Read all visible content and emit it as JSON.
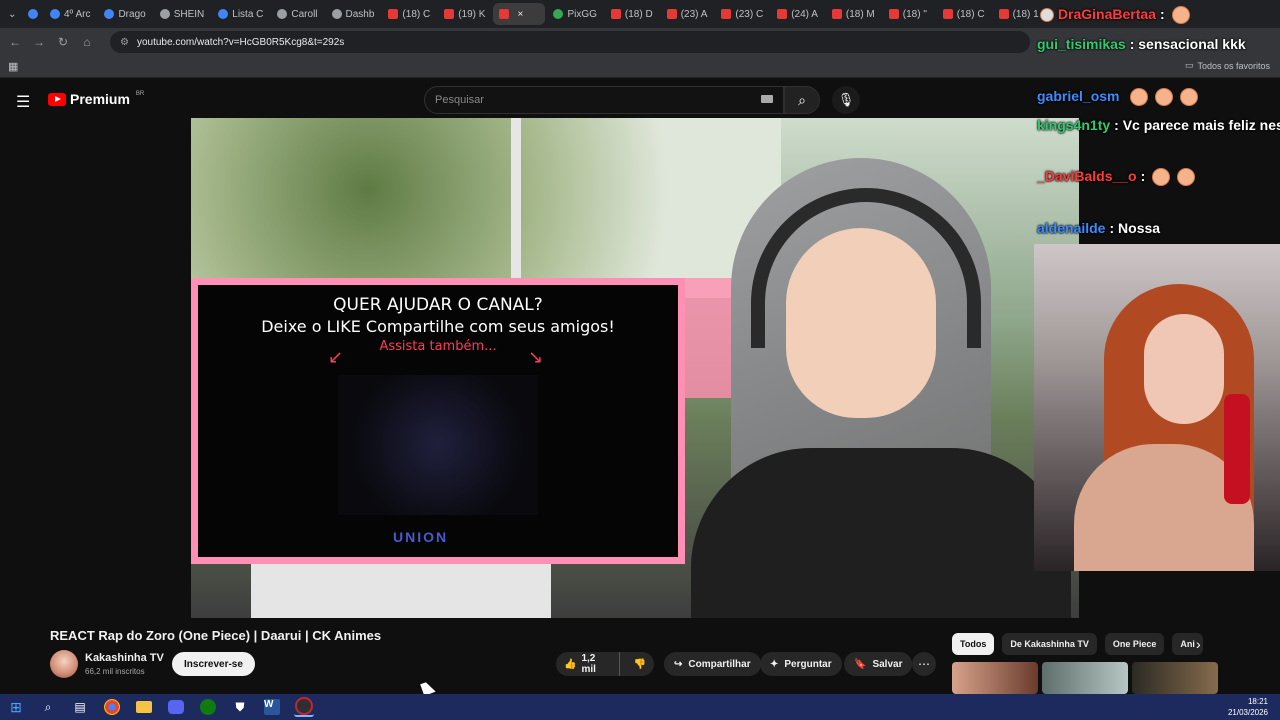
{
  "browser": {
    "tabs": [
      {
        "label": "4º Arc",
        "icon": "drive-icon"
      },
      {
        "label": "Drago",
        "icon": "drive-icon"
      },
      {
        "label": "SHEIN",
        "icon": "shein-icon"
      },
      {
        "label": "Lista C",
        "icon": "cloud-icon"
      },
      {
        "label": "Caroll",
        "icon": "circle-icon"
      },
      {
        "label": "Dashb",
        "icon": "dashboard-icon"
      },
      {
        "label": "(18) C",
        "icon": "youtube-icon"
      },
      {
        "label": "(19) K",
        "icon": "youtube-icon"
      },
      {
        "label": "",
        "icon": "youtube-icon",
        "active": true
      },
      {
        "label": "PixGG",
        "icon": "pixgg-icon"
      },
      {
        "label": "(18) D",
        "icon": "youtube-icon"
      },
      {
        "label": "(23) A",
        "icon": "youtube-icon"
      },
      {
        "label": "(23) C",
        "icon": "youtube-icon"
      },
      {
        "label": "(24) A",
        "icon": "youtube-icon"
      },
      {
        "label": "(18) M",
        "icon": "youtube-icon"
      },
      {
        "label": "(18) \"",
        "icon": "youtube-icon"
      },
      {
        "label": "(18) C",
        "icon": "youtube-icon"
      },
      {
        "label": "(18) 1",
        "icon": "youtube-icon"
      }
    ],
    "url": "youtube.com/watch?v=HcGB0R5Kcg8&t=292s",
    "bookmarks_label": "Todos os favoritos"
  },
  "youtube": {
    "logo_text": "Premium",
    "logo_region": "BR",
    "search_placeholder": "Pesquisar",
    "video_title": "REACT Rap do Zoro (One Piece) | Daarui | CK Animes",
    "channel_name": "Kakashinha TV",
    "channel_subs": "66,2 mil inscritos",
    "subscribe_label": "Inscrever-se",
    "like_count": "1,2 mil",
    "share_label": "Compartilhar",
    "ask_label": "Perguntar",
    "save_label": "Salvar",
    "chips": [
      "Todos",
      "De Kakashinha TV",
      "One Piece",
      "Ani"
    ]
  },
  "inner_video": {
    "line1": "QUER AJUDAR O CANAL?",
    "line2": "Deixe o LIKE Compartilhe com seus amigos!",
    "line3": "Assista também...",
    "logo": "UNION"
  },
  "chat": {
    "messages": [
      {
        "user": "DraGinaBertaa",
        "user_color": "#ff3b3b",
        "text": ""
      },
      {
        "user": "gui_tisimikas",
        "user_color": "#2ecc71",
        "text": "sensacional kkk"
      },
      {
        "user": "gabriel_osm",
        "user_color": "#3d8bff",
        "text": ""
      },
      {
        "user": "kings4n1ty",
        "user_color": "#2ecc71",
        "text": "Vc parece mais feliz nesse video"
      },
      {
        "user": "_DaviBalds__o",
        "user_color": "#ff3b3b",
        "text": ""
      },
      {
        "user": "aldenailde",
        "user_color": "#3d8bff",
        "text": "Nossa"
      }
    ]
  },
  "taskbar": {
    "time": "18:21",
    "date": "21/03/2026"
  }
}
